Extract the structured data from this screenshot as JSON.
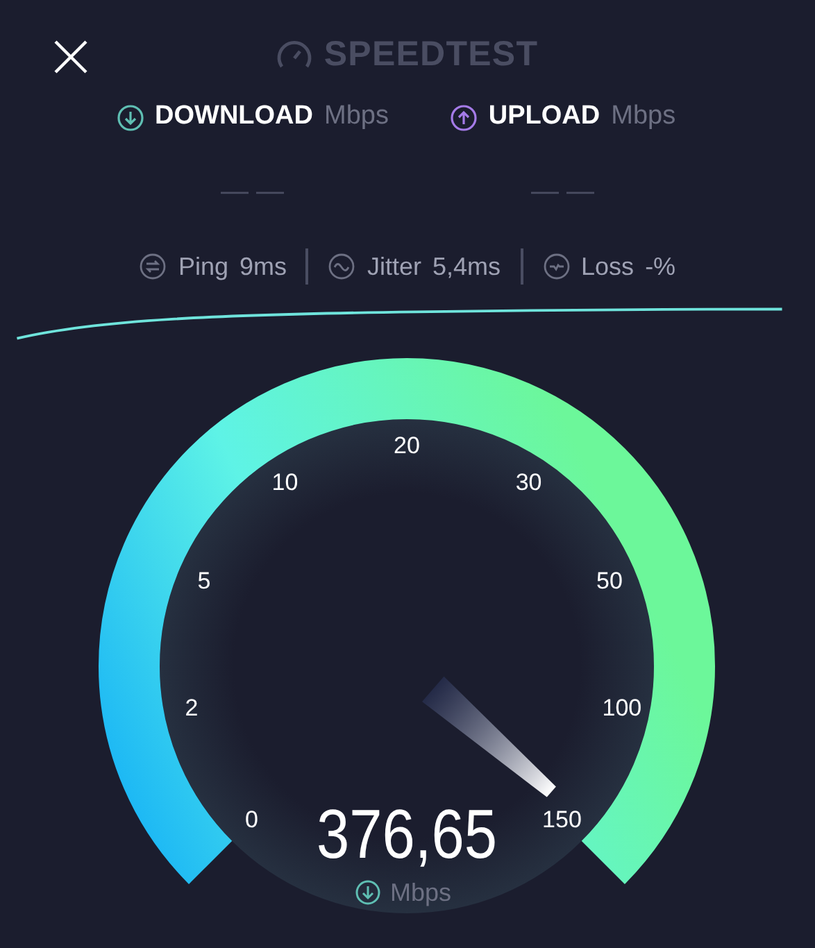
{
  "header": {
    "title": "SPEEDTEST"
  },
  "results": [
    {
      "kind": "download",
      "label": "DOWNLOAD",
      "unit": "Mbps",
      "value": "— —"
    },
    {
      "kind": "upload",
      "label": "UPLOAD",
      "unit": "Mbps",
      "value": "— —"
    }
  ],
  "stats": [
    {
      "kind": "ping",
      "label": "Ping",
      "value": "9ms"
    },
    {
      "kind": "jitter",
      "label": "Jitter",
      "value": "5,4ms"
    },
    {
      "kind": "loss",
      "label": "Loss",
      "value": "-%"
    }
  ],
  "gauge": {
    "ticks": [
      "0",
      "2",
      "5",
      "10",
      "20",
      "30",
      "50",
      "100",
      "150"
    ],
    "reading": "376,65",
    "unit": "Mbps"
  }
}
